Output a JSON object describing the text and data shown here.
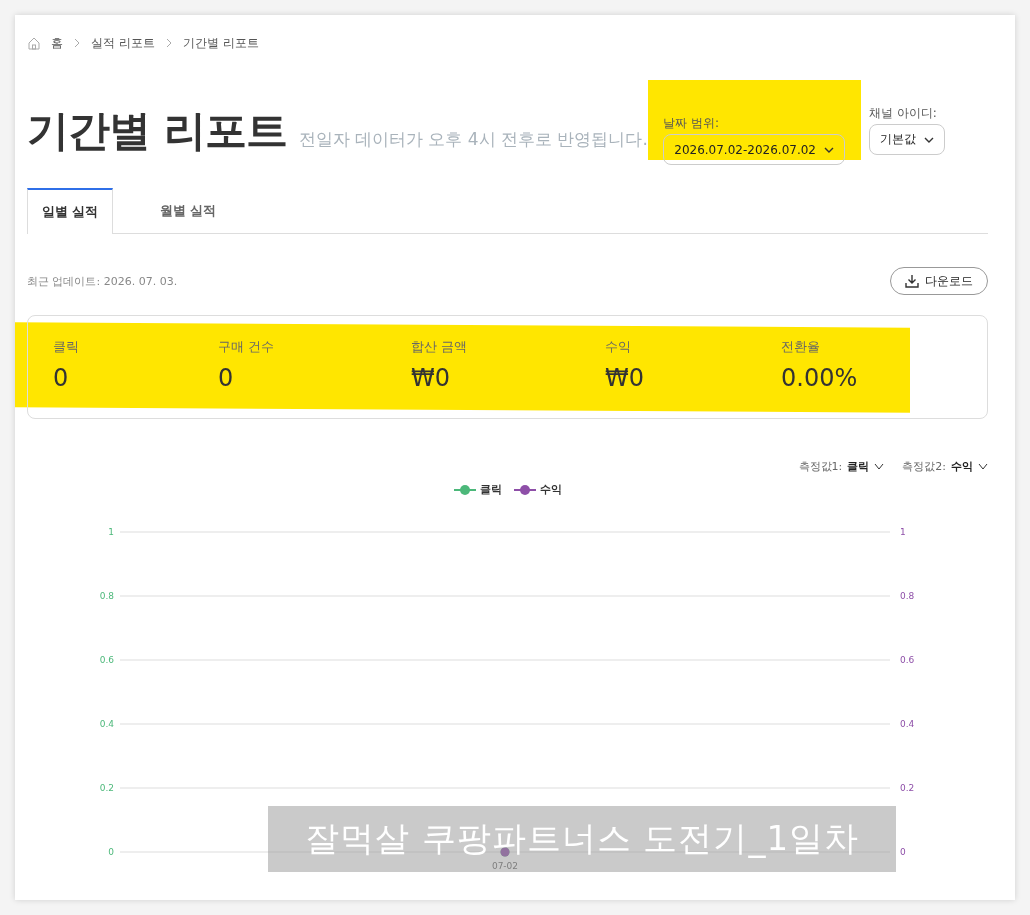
{
  "breadcrumb": [
    "홈",
    "실적 리포트",
    "기간별 리포트"
  ],
  "title": "기간별 리포트",
  "subtitle": "전일자 데이터가 오후 4시 전후로 반영됩니다.",
  "filters": [
    {
      "label": "날짜 범위:",
      "value": "2026.07.02-2026.07.02"
    },
    {
      "label": "채널 아이디:",
      "value": "기본값"
    }
  ],
  "tabs": [
    {
      "label": "일별 실적",
      "selected": true
    },
    {
      "label": "월별 실적",
      "selected": false
    }
  ],
  "last_updated": "최근 업데이트: 2026. 07. 03.",
  "download_button": "다운로드",
  "stats": [
    {
      "label": "클릭",
      "value": "0"
    },
    {
      "label": "구매 건수",
      "value": "0"
    },
    {
      "label": "합산 금액",
      "value": "₩0"
    },
    {
      "label": "수익",
      "value": "₩0"
    },
    {
      "label": "전환율",
      "value": "0.00%"
    }
  ],
  "metric_selectors": [
    {
      "label": "측정값1:",
      "value": "클릭"
    },
    {
      "label": "측정값2:",
      "value": "수익"
    }
  ],
  "chart_data": {
    "type": "line",
    "grid": true,
    "x": [
      "07-02"
    ],
    "ylim": [
      0,
      1
    ],
    "yticks": [
      0,
      0.2,
      0.4,
      0.6,
      0.8,
      1
    ],
    "series": [
      {
        "name": "클릭",
        "color": "#4cb87a",
        "marker": true,
        "values": [
          0
        ]
      },
      {
        "name": "수익",
        "color": "#8e4fa8",
        "marker": true,
        "values": [
          0
        ]
      }
    ]
  },
  "right_axis_labels": [
    "1",
    "0.8",
    "0.6",
    "0.4",
    "0.2",
    "0"
  ],
  "caption_overlay": "잘먹살 쿠팡파트너스 도전기_1일차"
}
